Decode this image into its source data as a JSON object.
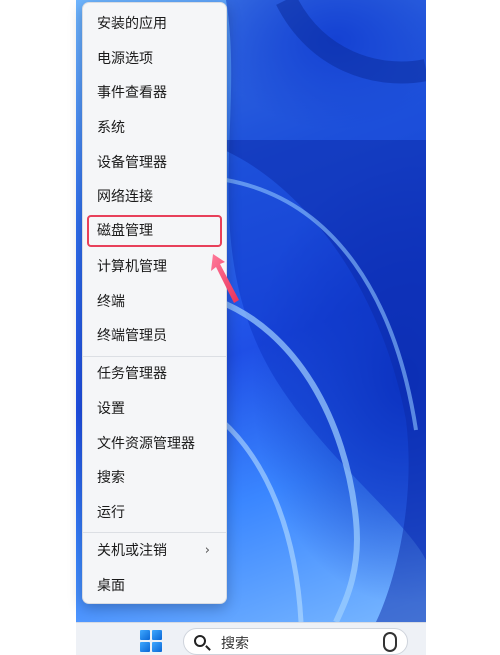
{
  "menu": {
    "items": [
      {
        "label": "安装的应用"
      },
      {
        "label": "电源选项"
      },
      {
        "label": "事件查看器"
      },
      {
        "label": "系统"
      },
      {
        "label": "设备管理器"
      },
      {
        "label": "网络连接"
      },
      {
        "label": "磁盘管理"
      },
      {
        "label": "计算机管理"
      },
      {
        "label": "终端"
      },
      {
        "label": "终端管理员"
      },
      {
        "label": "任务管理器"
      },
      {
        "label": "设置"
      },
      {
        "label": "文件资源管理器"
      },
      {
        "label": "搜索"
      },
      {
        "label": "运行"
      },
      {
        "label": "关机或注销",
        "chevron": "›"
      },
      {
        "label": "桌面"
      }
    ],
    "highlighted_item": "磁盘管理"
  },
  "taskbar": {
    "search_placeholder": "搜索"
  },
  "colors": {
    "highlight": "#e8405a",
    "accent": "#1f4fe6"
  },
  "icons": [
    "windows-start-icon",
    "search-icon",
    "copilot-badge-icon",
    "annotation-arrow-icon"
  ]
}
